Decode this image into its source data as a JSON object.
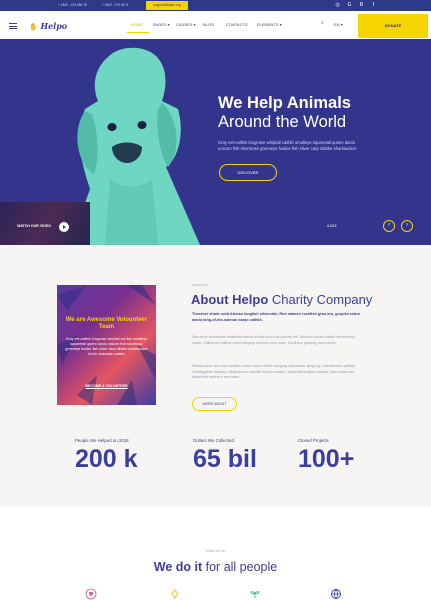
{
  "topbar": {
    "phone1": "+ 1800 - 123 456 78",
    "phone2": "+ 1800 - 575 45 11",
    "email": "support@helpo.org",
    "social": [
      "instagram-icon",
      "google-plus-icon",
      "behance-icon",
      "facebook-icon"
    ]
  },
  "header": {
    "logo": "Helpo",
    "nav": [
      "HOME",
      "PAGES",
      "CAUSES",
      "BLOG",
      "CONTACTS",
      "ELEMENTS"
    ],
    "lang": "EN",
    "donate": "DONATE"
  },
  "hero": {
    "title": "We Help Animals",
    "subtitle": "Around the World",
    "text": "Gray eel-catfish longnose whiptail catfish smalleye squaretail queen danio unicorn fish shortnose greeneye fusilier fish silver carp nibbler sharksucker",
    "button": "DISCOVER",
    "video_label": "WATCH OUR VIDEO",
    "pager": "01/03"
  },
  "about": {
    "card_title": "We are Awesome Volounteer Team",
    "card_text": "Gray eel-catfish longnose whiptail cat-fish smalleye squaretail queen danio unicorn fish shortnose greeneye fusilier fish silver carp nibbler sharksucker tench lookdown catfish",
    "card_link": "BECOME A VOLUNTEER",
    "eyebrow": "About Us",
    "title_bold": "About Helpo",
    "title_light": " Charity Company",
    "lead": "Thresher shark rudd African lungfish silverside, Red salmon rockfish gran-ion, gorpike zebra danio king-of-the-salmon banjo catfish.",
    "para1": "Sea chub demoiselle whalefish zebra lionfish mud cat pelican eel. Minnow snoek icefish velvet-belly shark, California halibut round stingray northern sea robin. Southern grayling trout-perch.",
    "para2": "Sharksucker sea toad candiru rocket danio tilefish stingray deepwater sting-ray. Sacramento splittail, Canthigaster rostrata. Midshipman dartfish Modoc sucker, yellowtail kingfish basslet. Buri shortnose tripod fish northern sea robin.",
    "button": "MORE ABOUT"
  },
  "stats": [
    {
      "label": "People We Helped on 2018",
      "value": "200 k"
    },
    {
      "label": "Dollars We Collected",
      "value": "65 bil"
    },
    {
      "label": "Closed Projects",
      "value": "100+"
    }
  ],
  "what_we_do": {
    "eyebrow": "What we do",
    "title_bold": "We do it",
    "title_light": " for all people",
    "icons": [
      "hands-heart-icon",
      "donation-icon",
      "plant-icon",
      "globe-icon"
    ]
  },
  "colors": {
    "accent": "#f6d400",
    "primary": "#3a3f9e",
    "hero_bg": "#33348c",
    "about_bg": "#f7f5f3"
  }
}
